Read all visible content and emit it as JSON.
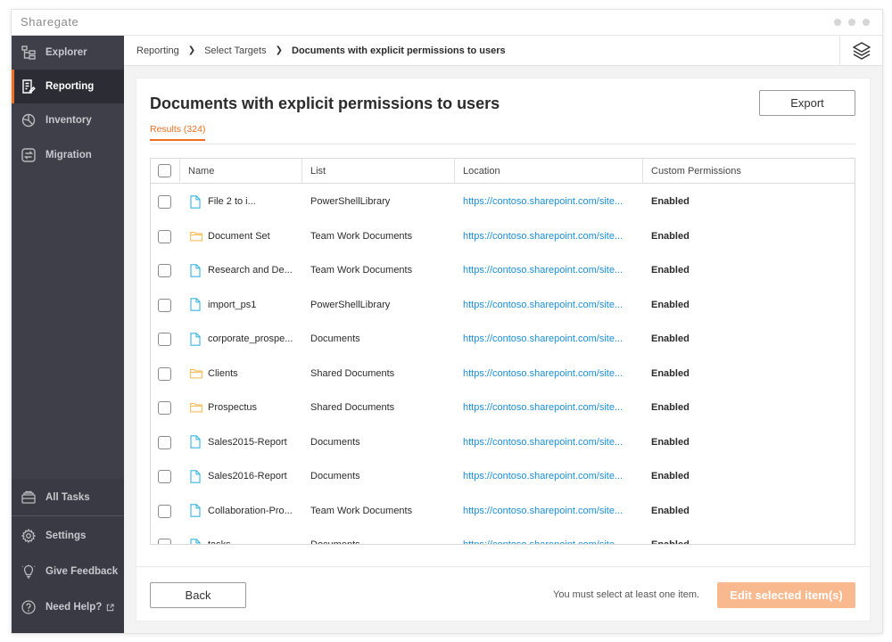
{
  "app": {
    "logo_text": "Sharegate"
  },
  "sidebar": {
    "items": [
      {
        "label": "Explorer",
        "icon": "explorer-tree-icon",
        "active": false
      },
      {
        "label": "Reporting",
        "icon": "report-icon",
        "active": true
      },
      {
        "label": "Inventory",
        "icon": "pie-chart-icon",
        "active": false
      },
      {
        "label": "Migration",
        "icon": "migration-arrows-icon",
        "active": false
      }
    ],
    "bottom_items": [
      {
        "label": "All Tasks",
        "icon": "tasks-icon"
      },
      {
        "label": "Settings",
        "icon": "gear-icon"
      },
      {
        "label": "Give Feedback",
        "icon": "lightbulb-icon"
      },
      {
        "label": "Need Help?",
        "icon": "help-icon",
        "external_icon": "external-link-icon"
      }
    ]
  },
  "breadcrumb": {
    "items": [
      "Reporting",
      "Select Targets",
      "Documents with explicit permissions to users"
    ]
  },
  "header": {
    "title": "Documents with explicit permissions to users",
    "export_label": "Export",
    "results_tab": "Results (324)"
  },
  "table": {
    "columns": [
      "Name",
      "List",
      "Location",
      "Custom Permissions"
    ],
    "rows": [
      {
        "type": "file",
        "name": "File 2 to i...",
        "list": "PowerShellLibrary",
        "location": "https://contoso.sharepoint.com/site...",
        "permissions": "Enabled"
      },
      {
        "type": "folder",
        "name": "Document Set",
        "list": "Team Work Documents",
        "location": "https://contoso.sharepoint.com/site...",
        "permissions": "Enabled"
      },
      {
        "type": "file",
        "name": "Research and De...",
        "list": "Team Work Documents",
        "location": "https://contoso.sharepoint.com/site...",
        "permissions": "Enabled"
      },
      {
        "type": "file",
        "name": "import_ps1",
        "list": "PowerShellLibrary",
        "location": "https://contoso.sharepoint.com/site...",
        "permissions": "Enabled"
      },
      {
        "type": "file",
        "name": "corporate_prospe...",
        "list": "Documents",
        "location": "https://contoso.sharepoint.com/site...",
        "permissions": "Enabled"
      },
      {
        "type": "folder",
        "name": "Clients",
        "list": "Shared Documents",
        "location": "https://contoso.sharepoint.com/site...",
        "permissions": "Enabled"
      },
      {
        "type": "folder",
        "name": "Prospectus",
        "list": "Shared Documents",
        "location": "https://contoso.sharepoint.com/site...",
        "permissions": "Enabled"
      },
      {
        "type": "file",
        "name": "Sales2015-Report",
        "list": "Documents",
        "location": "https://contoso.sharepoint.com/site...",
        "permissions": "Enabled"
      },
      {
        "type": "file",
        "name": "Sales2016-Report",
        "list": "Documents",
        "location": "https://contoso.sharepoint.com/site...",
        "permissions": "Enabled"
      },
      {
        "type": "file",
        "name": "Collaboration-Pro...",
        "list": "Team Work Documents",
        "location": "https://contoso.sharepoint.com/site...",
        "permissions": "Enabled"
      },
      {
        "type": "file",
        "name": "tasks",
        "list": "Documents",
        "location": "https://contoso.sharepoint.com/site...",
        "permissions": "Enabled"
      }
    ]
  },
  "footer": {
    "back_label": "Back",
    "helper_text": "You must select at least one item.",
    "edit_label": "Edit selected item(s)"
  },
  "colors": {
    "accent": "#f26f21",
    "link": "#1a8fd8",
    "sidebar_bg": "#3f3f49",
    "file_icon": "#35b5e5",
    "folder_icon": "#f5b94a",
    "edit_button_disabled": "#f8b98f"
  }
}
